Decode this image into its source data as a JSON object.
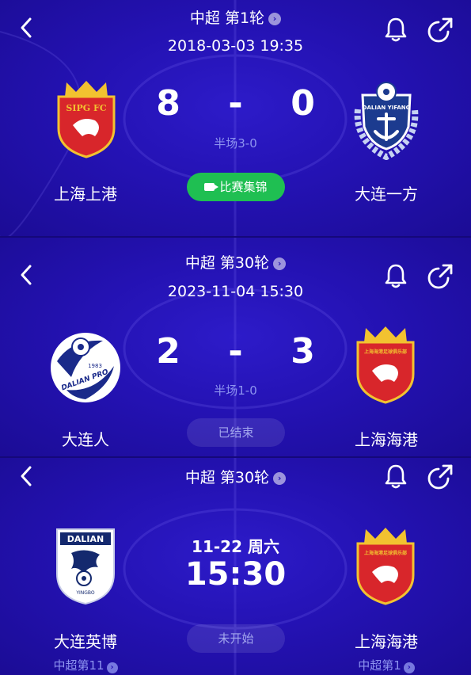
{
  "colors": {
    "panel": "#2412b3",
    "accent_green": "#1fbf52",
    "muted_text": "#8d93ef",
    "sipg_red": "#d8262b",
    "gold": "#f2c230"
  },
  "icons": [
    "back-arrow-icon",
    "bell-icon",
    "share-icon",
    "chevron-right-icon",
    "video-icon"
  ],
  "matches": [
    {
      "round": "中超 第1轮",
      "datetime": "2018-03-03 19:35",
      "home": {
        "name": "上海上港",
        "badge_text": "SIPG FC"
      },
      "away": {
        "name": "大连一方",
        "badge_text": "DALIAN YIFANG"
      },
      "home_score": "8",
      "away_score": "0",
      "separator": "-",
      "halftime": "半场3-0",
      "button": "比赛集锦"
    },
    {
      "round": "中超 第30轮",
      "datetime": "2023-11-04 15:30",
      "home": {
        "name": "大连人",
        "badge_text": "DALIAN PRO",
        "badge_year": "1983"
      },
      "away": {
        "name": "上海海港",
        "badge_text": "上海海港足球俱乐部"
      },
      "home_score": "2",
      "away_score": "3",
      "separator": "-",
      "halftime": "半场1-0",
      "status": "已结束"
    },
    {
      "round": "中超 第30轮",
      "kickoff_date": "11-22 周六",
      "kickoff_time": "15:30",
      "home": {
        "name": "大连英博",
        "badge_text": "DALIAN",
        "badge_sub": "YINGBO",
        "rank": "中超第11"
      },
      "away": {
        "name": "上海海港",
        "badge_text": "上海海港足球俱乐部",
        "rank": "中超第1"
      },
      "status": "未开始"
    }
  ]
}
